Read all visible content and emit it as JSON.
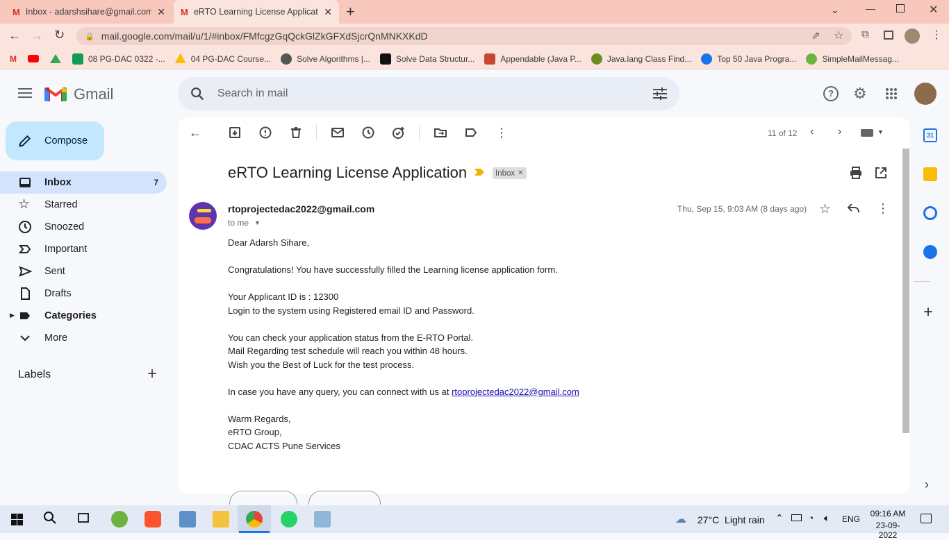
{
  "browser": {
    "tabs": [
      {
        "title": "Inbox - adarshsihare@gmail.com",
        "active": false
      },
      {
        "title": "eRTO Learning License Applicatio",
        "active": true
      }
    ],
    "url": "mail.google.com/mail/u/1/#inbox/FMfcgzGqQckGlZkGFXdSjcrQnMNKXKdD",
    "bookmarks": [
      "08 PG-DAC 0322 -...",
      "04 PG-DAC Course...",
      "Solve Algorithms |...",
      "Solve Data Structur...",
      "Appendable (Java P...",
      "Java.lang Class Find...",
      "Top 50 Java Progra...",
      "SimpleMailMessag..."
    ]
  },
  "gmail": {
    "logo_text": "Gmail",
    "search_placeholder": "Search in mail",
    "compose_label": "Compose",
    "nav": [
      {
        "label": "Inbox",
        "count": "7",
        "icon": "inbox-icon"
      },
      {
        "label": "Starred",
        "count": "",
        "icon": "star-icon"
      },
      {
        "label": "Snoozed",
        "count": "",
        "icon": "clock-icon"
      },
      {
        "label": "Important",
        "count": "",
        "icon": "important-icon"
      },
      {
        "label": "Sent",
        "count": "",
        "icon": "send-icon"
      },
      {
        "label": "Drafts",
        "count": "",
        "icon": "draft-icon"
      },
      {
        "label": "Categories",
        "count": "",
        "icon": "label-icon"
      },
      {
        "label": "More",
        "count": "",
        "icon": "chevron-down-icon"
      }
    ],
    "labels_heading": "Labels",
    "pagination": "11 of 12"
  },
  "email": {
    "subject": "eRTO Learning License Application",
    "label_chip": "Inbox",
    "sender": "rtoprojectedac2022@gmail.com",
    "recipient": "to me",
    "date": "Thu, Sep 15, 9:03 AM (8 days ago)",
    "body": {
      "greeting": "Dear Adarsh Sihare,",
      "line1": "Congratulations! You have successfully filled the Learning license application form.",
      "line2": "Your Applicant ID is : 12300",
      "line3": "Login to the system using Registered email ID and Password.",
      "line4": "You can check your application status from the E-RTO Portal.",
      "line5": "Mail Regarding test schedule will reach you within 48 hours.",
      "line6": "Wish you the Best of Luck for the test process.",
      "line7": "In case you have any query, you can connect with us at",
      "link": "rtoprojectedac2022@gmail.com",
      "sign1": "Warm Regards,",
      "sign2": "eRTO Group,",
      "sign3": "CDAC ACTS Pune Services"
    }
  },
  "taskbar": {
    "weather": "27°C  Light rain",
    "language": "ENG",
    "time": "09:16 AM",
    "date": "23-09-2022"
  },
  "colors": {
    "tabstrip": "#f8c8bd",
    "toolbar": "#fbe4de",
    "compose": "#c2e7ff",
    "inbox_active": "#d3e3fd",
    "link": "#1a0dab"
  }
}
